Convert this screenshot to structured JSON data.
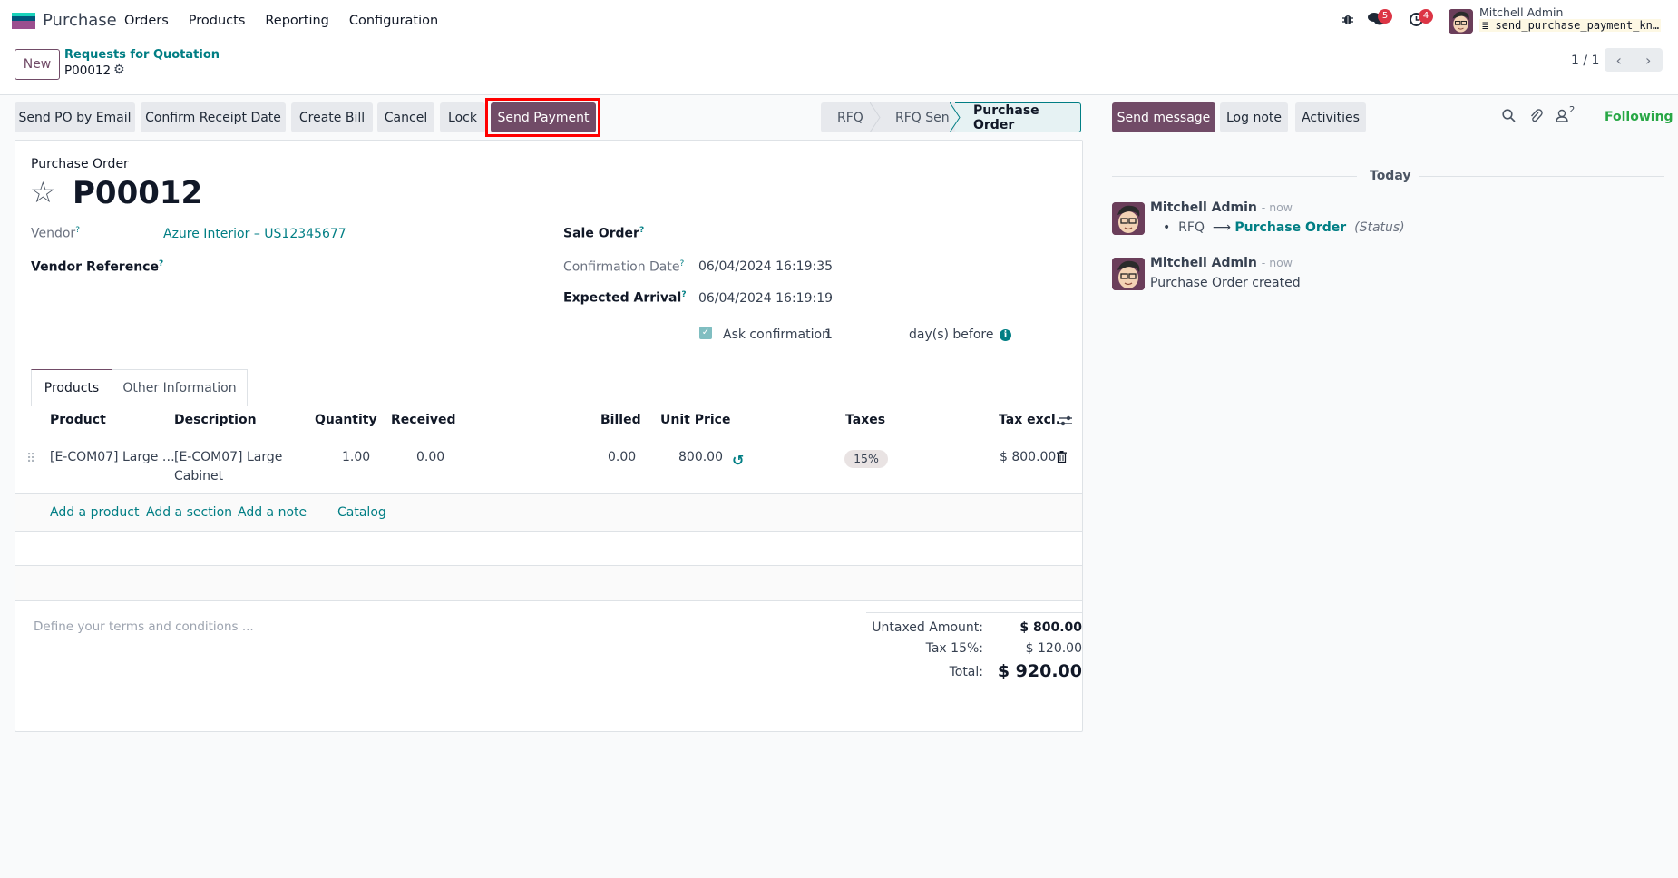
{
  "navbar": {
    "app_name": "Purchase",
    "menu": [
      "Orders",
      "Products",
      "Reporting",
      "Configuration"
    ],
    "messages_count": "5",
    "activities_count": "4",
    "user_name": "Mitchell Admin",
    "database": "send_purchase_payment_kn…"
  },
  "control_panel": {
    "new_label": "New",
    "breadcrumb_parent": "Requests for Quotation",
    "breadcrumb_current": "P00012",
    "pager": "1 / 1"
  },
  "actions": {
    "buttons": [
      "Send PO by Email",
      "Confirm Receipt Date",
      "Create Bill",
      "Cancel",
      "Lock",
      "Send Payment"
    ],
    "highlighted": "Send Payment"
  },
  "statusbar": {
    "stages": [
      "RFQ",
      "RFQ Sent",
      "Purchase Order"
    ],
    "active": "Purchase Order"
  },
  "form": {
    "title_label": "Purchase Order",
    "record_name": "P00012",
    "vendor_label": "Vendor",
    "vendor_value": "Azure Interior – US12345677",
    "vendor_ref_label": "Vendor Reference",
    "sale_order_label": "Sale Order",
    "confirmation_date_label": "Confirmation Date",
    "confirmation_date": "06/04/2024 16:19:35",
    "expected_arrival_label": "Expected Arrival",
    "expected_arrival": "06/04/2024 16:19:19",
    "ask_confirmation_label": "Ask confirmation",
    "ask_confirmation_days": "1",
    "ask_confirmation_suffix": "day(s) before",
    "ask_confirmation_checked": true,
    "help_mark": "?"
  },
  "tabs": [
    "Products",
    "Other Information"
  ],
  "order_lines": {
    "columns": [
      "Product",
      "Description",
      "Quantity",
      "Received",
      "Billed",
      "Unit Price",
      "Taxes",
      "Tax excl."
    ],
    "rows": [
      {
        "product": "[E-COM07] Large …",
        "description_line1": "[E-COM07] Large",
        "description_line2": "Cabinet",
        "quantity": "1.00",
        "received": "0.00",
        "billed": "0.00",
        "unit_price": "800.00",
        "taxes": "15%",
        "subtotal": "$ 800.00"
      }
    ],
    "add_links": [
      "Add a product",
      "Add a section",
      "Add a note",
      "Catalog"
    ]
  },
  "terms_placeholder": "Define your terms and conditions ...",
  "totals": {
    "untaxed_label": "Untaxed Amount:",
    "untaxed_value": "$ 800.00",
    "tax_label": "Tax 15%:",
    "tax_value": "$ 120.00",
    "total_label": "Total:",
    "total_value": "$ 920.00"
  },
  "chatter": {
    "send_message": "Send message",
    "log_note": "Log note",
    "activities": "Activities",
    "followers_count": "2",
    "following": "Following",
    "date_separator": "Today",
    "messages": [
      {
        "author": "Mitchell Admin",
        "time": "- now",
        "old": "RFQ",
        "arrow": "⟶",
        "new": "Purchase Order",
        "field": "(Status)"
      },
      {
        "author": "Mitchell Admin",
        "time": "- now",
        "body": "Purchase Order created"
      }
    ]
  },
  "colors": {
    "brand": "#714b67",
    "link": "#017e84",
    "following": "#28a745",
    "highlight": "#ff0000"
  }
}
